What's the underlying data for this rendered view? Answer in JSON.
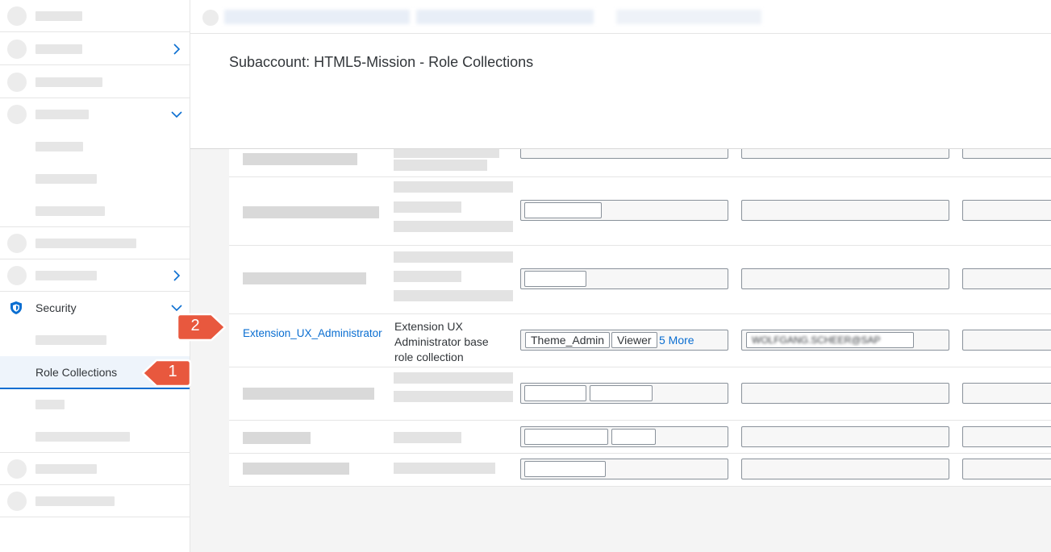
{
  "header": {
    "title": "Subaccount: HTML5-Mission - Role Collections"
  },
  "sidebar": {
    "security_label": "Security",
    "role_collections_label": "Role Collections"
  },
  "table": {
    "highlight_row": {
      "name": "Extension_UX_Administrator",
      "description": "Extension UX Administrator base role collection",
      "roles": [
        "Theme_Admin",
        "Viewer"
      ],
      "more_link": "5 More"
    }
  },
  "callouts": {
    "one": "1",
    "two": "2"
  },
  "colors": {
    "accent": "#0a6ed1",
    "callout": "#e8583e",
    "active_bg": "#eef4fb"
  }
}
